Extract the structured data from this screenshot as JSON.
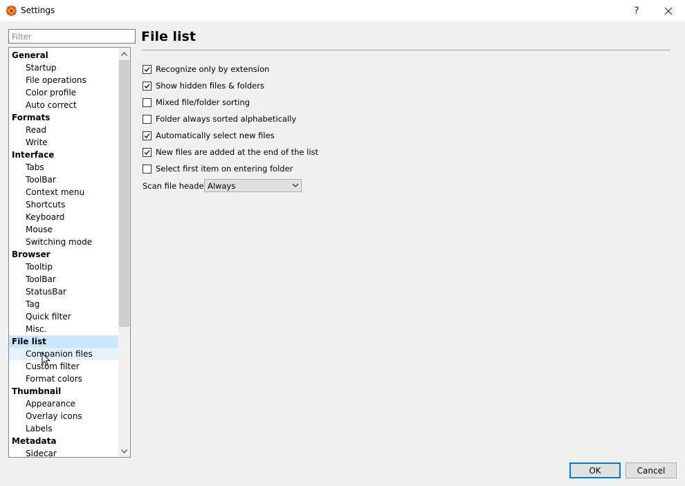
{
  "window": {
    "title": "Settings",
    "help_label": "?",
    "close_label": "✕"
  },
  "filter": {
    "placeholder": "Filter",
    "value": ""
  },
  "tree": [
    {
      "label": "General",
      "level": 0,
      "state": ""
    },
    {
      "label": "Startup",
      "level": 1,
      "state": ""
    },
    {
      "label": "File operations",
      "level": 1,
      "state": ""
    },
    {
      "label": "Color profile",
      "level": 1,
      "state": ""
    },
    {
      "label": "Auto correct",
      "level": 1,
      "state": ""
    },
    {
      "label": "Formats",
      "level": 0,
      "state": ""
    },
    {
      "label": "Read",
      "level": 1,
      "state": ""
    },
    {
      "label": "Write",
      "level": 1,
      "state": ""
    },
    {
      "label": "Interface",
      "level": 0,
      "state": ""
    },
    {
      "label": "Tabs",
      "level": 1,
      "state": ""
    },
    {
      "label": "ToolBar",
      "level": 1,
      "state": ""
    },
    {
      "label": "Context menu",
      "level": 1,
      "state": ""
    },
    {
      "label": "Shortcuts",
      "level": 1,
      "state": ""
    },
    {
      "label": "Keyboard",
      "level": 1,
      "state": ""
    },
    {
      "label": "Mouse",
      "level": 1,
      "state": ""
    },
    {
      "label": "Switching mode",
      "level": 1,
      "state": ""
    },
    {
      "label": "Browser",
      "level": 0,
      "state": ""
    },
    {
      "label": "Tooltip",
      "level": 1,
      "state": ""
    },
    {
      "label": "ToolBar",
      "level": 1,
      "state": ""
    },
    {
      "label": "StatusBar",
      "level": 1,
      "state": ""
    },
    {
      "label": "Tag",
      "level": 1,
      "state": ""
    },
    {
      "label": "Quick filter",
      "level": 1,
      "state": ""
    },
    {
      "label": "Misc.",
      "level": 1,
      "state": ""
    },
    {
      "label": "File list",
      "level": 0,
      "state": "selected"
    },
    {
      "label": "Companion files",
      "level": 1,
      "state": "hover"
    },
    {
      "label": "Custom filter",
      "level": 1,
      "state": ""
    },
    {
      "label": "Format colors",
      "level": 1,
      "state": ""
    },
    {
      "label": "Thumbnail",
      "level": 0,
      "state": ""
    },
    {
      "label": "Appearance",
      "level": 1,
      "state": ""
    },
    {
      "label": "Overlay icons",
      "level": 1,
      "state": ""
    },
    {
      "label": "Labels",
      "level": 1,
      "state": ""
    },
    {
      "label": "Metadata",
      "level": 0,
      "state": ""
    },
    {
      "label": "Sidecar",
      "level": 1,
      "state": ""
    }
  ],
  "page": {
    "title": "File list",
    "options": [
      {
        "label": "Recognize only by extension",
        "checked": true
      },
      {
        "label": "Show hidden files & folders",
        "checked": true
      },
      {
        "label": "Mixed file/folder sorting",
        "checked": false
      },
      {
        "label": "Folder always sorted alphabetically",
        "checked": false
      },
      {
        "label": "Automatically select new files",
        "checked": true
      },
      {
        "label": "New files are added at the end of the list",
        "checked": true
      },
      {
        "label": "Select first item on entering folder",
        "checked": false
      }
    ],
    "scan_headers": {
      "label": "Scan file headers",
      "value": "Always"
    }
  },
  "buttons": {
    "ok": "OK",
    "cancel": "Cancel"
  },
  "colors": {
    "selected_row": "#cce8ff",
    "hover_row": "#e5f3ff",
    "default_button_border": "#0078d7",
    "dialog_background": "#f0f0f0"
  },
  "icons": {
    "app": "xnview-app-icon",
    "scroll_up": "chevron-up-icon",
    "scroll_down": "chevron-down-icon",
    "dropdown": "chevron-down-icon",
    "check": "check-icon"
  }
}
